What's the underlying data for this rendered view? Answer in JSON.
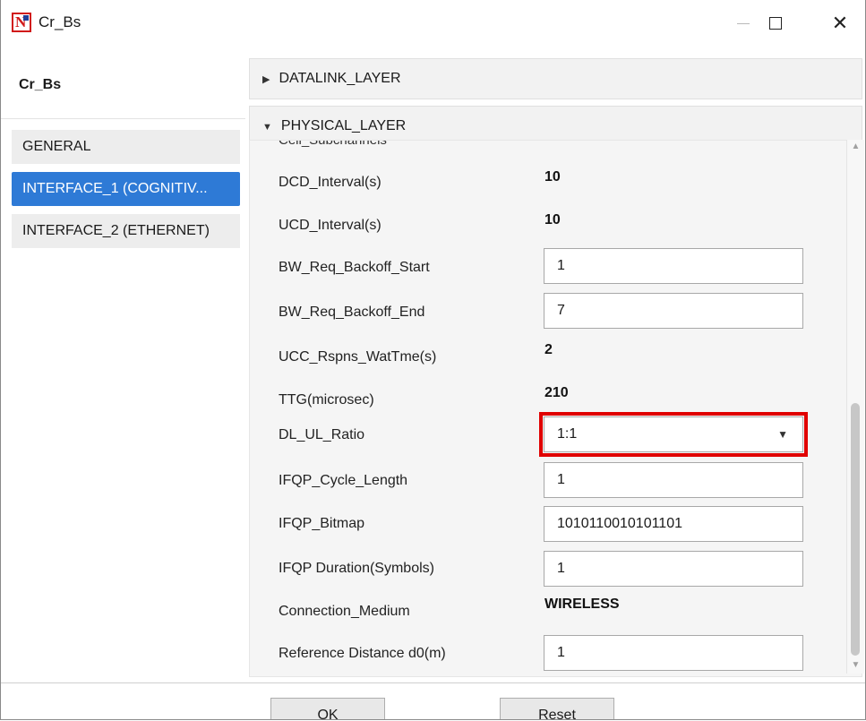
{
  "window": {
    "title": "Cr_Bs"
  },
  "sidebar": {
    "node_title": "Cr_Bs",
    "items": [
      {
        "label": "GENERAL"
      },
      {
        "label": "INTERFACE_1 (COGNITIV..."
      },
      {
        "label": "INTERFACE_2 (ETHERNET)"
      }
    ]
  },
  "accordion": {
    "datalink": {
      "label": "DATALINK_LAYER"
    },
    "physical": {
      "label": "PHYSICAL_LAYER"
    }
  },
  "physical": {
    "partial_row_label": "Cell_Subchannels",
    "rows": [
      {
        "label": "DCD_Interval(s)",
        "value": "10"
      },
      {
        "label": "UCD_Interval(s)",
        "value": "10"
      },
      {
        "label": "BW_Req_Backoff_Start",
        "value": "1"
      },
      {
        "label": "BW_Req_Backoff_End",
        "value": "7"
      },
      {
        "label": "UCC_Rspns_WatTme(s)",
        "value": "2"
      },
      {
        "label": "TTG(microsec)",
        "value": "210"
      },
      {
        "label": "DL_UL_Ratio",
        "value": "1:1"
      },
      {
        "label": "IFQP_Cycle_Length",
        "value": "1"
      },
      {
        "label": "IFQP_Bitmap",
        "value": "1010110010101101"
      },
      {
        "label": "IFQP Duration(Symbols)",
        "value": "1"
      },
      {
        "label": "Connection_Medium",
        "value": "WIRELESS"
      },
      {
        "label": "Reference Distance d0(m)",
        "value": "1"
      }
    ]
  },
  "footer": {
    "ok_label": "OK",
    "reset_label": "Reset"
  },
  "colors": {
    "selected": "#2e7ad6",
    "highlight": "#e00000"
  },
  "icons": [
    "app-logo-icon",
    "minimize-icon",
    "maximize-icon",
    "close-icon",
    "expand-arrow-icon",
    "collapse-arrow-icon",
    "dropdown-caret-icon",
    "scroll-up-icon",
    "scroll-down-icon"
  ]
}
